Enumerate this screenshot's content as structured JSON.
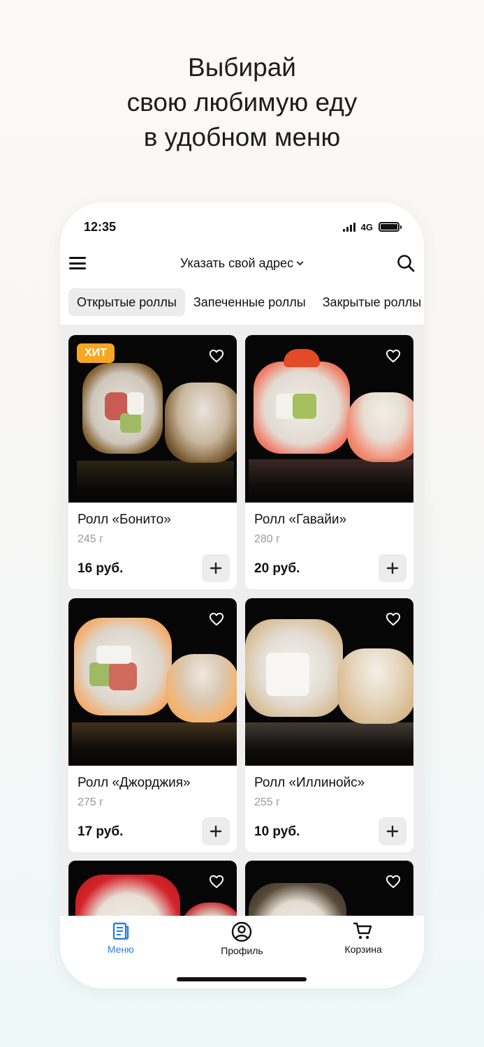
{
  "headline": {
    "line1": "Выбирай",
    "line2": "свою любимую еду",
    "line3": "в удобном меню"
  },
  "status_bar": {
    "time": "12:35",
    "network": "4G"
  },
  "app_bar": {
    "address_label": "Указать свой адрес"
  },
  "tabs": [
    {
      "label": "Открытые роллы",
      "active": true
    },
    {
      "label": "Запеченные роллы",
      "active": false
    },
    {
      "label": "Закрытые роллы",
      "active": false
    }
  ],
  "products": [
    {
      "name": "Ролл «Бонито»",
      "weight": "245 г",
      "price": "16 руб.",
      "badge": "ХИТ"
    },
    {
      "name": "Ролл «Гавайи»",
      "weight": "280 г",
      "price": "20 руб."
    },
    {
      "name": "Ролл «Джорджия»",
      "weight": "275 г",
      "price": "17 руб."
    },
    {
      "name": "Ролл «Иллинойс»",
      "weight": "255 г",
      "price": "10 руб."
    }
  ],
  "bottom_nav": [
    {
      "label": "Меню",
      "icon": "menu-doc-icon",
      "active": true
    },
    {
      "label": "Профиль",
      "icon": "profile-icon",
      "active": false
    },
    {
      "label": "Корзина",
      "icon": "cart-icon",
      "active": false
    }
  ],
  "colors": {
    "accent": "#2a7de1",
    "badge": "#f7a623"
  }
}
